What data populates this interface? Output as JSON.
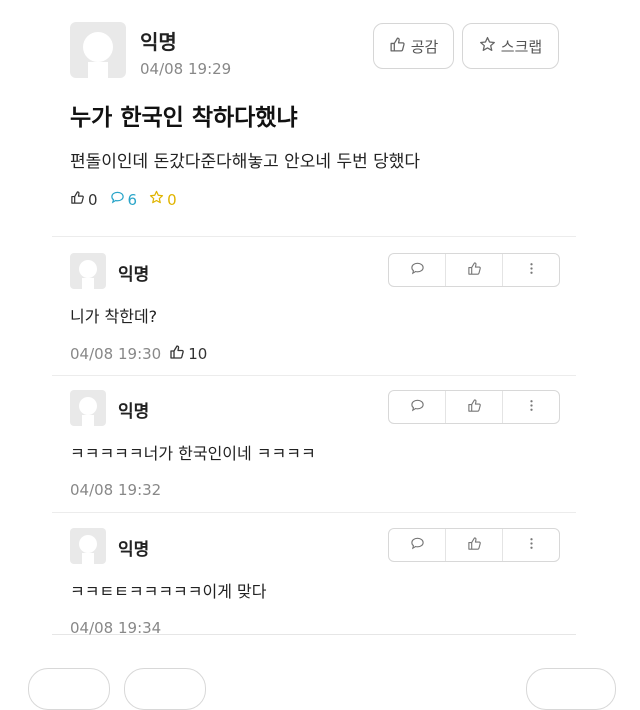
{
  "post": {
    "author": "익명",
    "time": "04/08 19:29",
    "like_label": "공감",
    "scrap_label": "스크랩",
    "title": "누가 한국인 착하다했냐",
    "body": "편돌이인데 돈갔다준다해놓고 안오네 두번 당했다",
    "stats": {
      "likes": "0",
      "comments": "6",
      "scraps": "0"
    }
  },
  "comments": [
    {
      "author": "익명",
      "text": "니가 착한데?",
      "time": "04/08 19:30",
      "likes": "10"
    },
    {
      "author": "익명",
      "text": "ㅋㅋㅋㅋㅋ너가 한국인이네 ㅋㅋㅋㅋ",
      "time": "04/08 19:32"
    },
    {
      "author": "익명",
      "text": "ㅋㅋㅌㅌㅋㅋㅋㅋㅋ이게 맞다",
      "time": "04/08 19:34"
    }
  ],
  "icons": {
    "thumbs_up": "thumbs-up-icon",
    "comment": "speech-bubble-icon",
    "star": "star-icon",
    "more": "vertical-dots-icon"
  },
  "colors": {
    "comment_count": "#2aa5c9",
    "scrap_count": "#e0b400",
    "muted": "#888888"
  }
}
